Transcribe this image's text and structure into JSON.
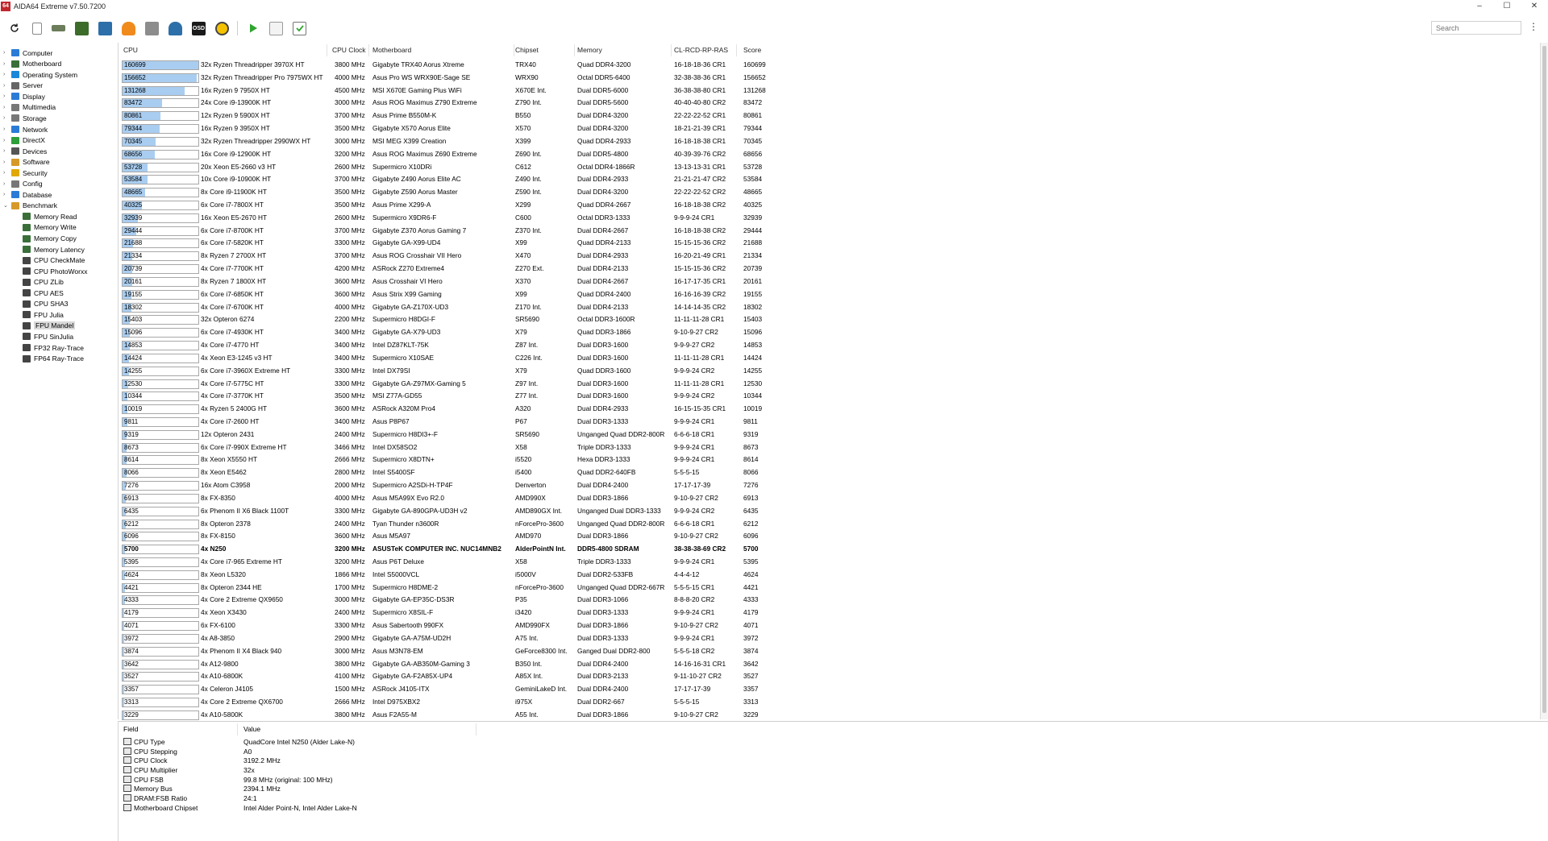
{
  "window": {
    "title": "AIDA64 Extreme v7.50.7200",
    "app_icon_text": "64",
    "minimize": "–",
    "maximize": "☐",
    "close": "✕"
  },
  "toolbar": {
    "icons": [
      "refresh-icon",
      "report-icon",
      "memory-icon",
      "motherboard-icon",
      "hardware-icon",
      "flame-icon",
      "network-icon",
      "user-icon",
      "osd-icon",
      "gauge-icon",
      "play-icon",
      "list-icon",
      "checklist-icon"
    ],
    "osd_label": "OSD",
    "search_placeholder": "Search",
    "menu_label": "⋮"
  },
  "tree": [
    {
      "label": "Computer",
      "arrow": "›",
      "color": "#2b7bd6"
    },
    {
      "label": "Motherboard",
      "arrow": "›",
      "color": "#3a6f3a"
    },
    {
      "label": "Operating System",
      "arrow": "›",
      "color": "#1c86d9"
    },
    {
      "label": "Server",
      "arrow": "›",
      "color": "#666666"
    },
    {
      "label": "Display",
      "arrow": "›",
      "color": "#2b7bd6"
    },
    {
      "label": "Multimedia",
      "arrow": "›",
      "color": "#777777"
    },
    {
      "label": "Storage",
      "arrow": "›",
      "color": "#777777"
    },
    {
      "label": "Network",
      "arrow": "›",
      "color": "#2b7bd6"
    },
    {
      "label": "DirectX",
      "arrow": "›",
      "color": "#2e9e3a"
    },
    {
      "label": "Devices",
      "arrow": "›",
      "color": "#555555"
    },
    {
      "label": "Software",
      "arrow": "›",
      "color": "#d69a2b"
    },
    {
      "label": "Security",
      "arrow": "›",
      "color": "#e0a800"
    },
    {
      "label": "Config",
      "arrow": "›",
      "color": "#777777"
    },
    {
      "label": "Database",
      "arrow": "›",
      "color": "#2b7bd6"
    },
    {
      "label": "Benchmark",
      "arrow": "⌄",
      "color": "#d69a2b"
    },
    {
      "label": "Memory Read",
      "arrow": "",
      "color": "#3a6f3a",
      "child": true
    },
    {
      "label": "Memory Write",
      "arrow": "",
      "color": "#3a6f3a",
      "child": true
    },
    {
      "label": "Memory Copy",
      "arrow": "",
      "color": "#3a6f3a",
      "child": true
    },
    {
      "label": "Memory Latency",
      "arrow": "",
      "color": "#3a6f3a",
      "child": true
    },
    {
      "label": "CPU CheckMate",
      "arrow": "",
      "color": "#444444",
      "child": true
    },
    {
      "label": "CPU PhotoWorxx",
      "arrow": "",
      "color": "#444444",
      "child": true
    },
    {
      "label": "CPU ZLib",
      "arrow": "",
      "color": "#444444",
      "child": true
    },
    {
      "label": "CPU AES",
      "arrow": "",
      "color": "#444444",
      "child": true
    },
    {
      "label": "CPU SHA3",
      "arrow": "",
      "color": "#444444",
      "child": true
    },
    {
      "label": "FPU Julia",
      "arrow": "",
      "color": "#444444",
      "child": true
    },
    {
      "label": "FPU Mandel",
      "arrow": "",
      "color": "#444444",
      "child": true,
      "selected": true
    },
    {
      "label": "FPU SinJulia",
      "arrow": "",
      "color": "#444444",
      "child": true
    },
    {
      "label": "FP32 Ray-Trace",
      "arrow": "",
      "color": "#444444",
      "child": true
    },
    {
      "label": "FP64 Ray-Trace",
      "arrow": "",
      "color": "#444444",
      "child": true
    }
  ],
  "list": {
    "headers": {
      "cpu": "CPU",
      "clock": "CPU Clock",
      "motherboard": "Motherboard",
      "chipset": "Chipset",
      "memory": "Memory",
      "timing": "CL-RCD-RP-RAS",
      "score": "Score"
    },
    "max_score": 160699,
    "rows": [
      {
        "score": "160699",
        "cpu": "32x Ryzen Threadripper 3970X HT",
        "clock": "3800 MHz",
        "mb": "Gigabyte TRX40 Aorus Xtreme",
        "chipset": "TRX40",
        "mem": "Quad DDR4-3200",
        "timing": "16-18-18-36 CR1"
      },
      {
        "score": "156652",
        "cpu": "32x Ryzen Threadripper Pro 7975WX HT",
        "clock": "4000 MHz",
        "mb": "Asus Pro WS WRX90E-Sage SE",
        "chipset": "WRX90",
        "mem": "Octal DDR5-6400",
        "timing": "32-38-38-36 CR1"
      },
      {
        "score": "131268",
        "cpu": "16x Ryzen 9 7950X HT",
        "clock": "4500 MHz",
        "mb": "MSI X670E Gaming Plus WiFi",
        "chipset": "X670E Int.",
        "mem": "Dual DDR5-6000",
        "timing": "36-38-38-80 CR1"
      },
      {
        "score": "83472",
        "cpu": "24x Core i9-13900K HT",
        "clock": "3000 MHz",
        "mb": "Asus ROG Maximus Z790 Extreme",
        "chipset": "Z790 Int.",
        "mem": "Dual DDR5-5600",
        "timing": "40-40-40-80 CR2"
      },
      {
        "score": "80861",
        "cpu": "12x Ryzen 9 5900X HT",
        "clock": "3700 MHz",
        "mb": "Asus Prime B550M-K",
        "chipset": "B550",
        "mem": "Dual DDR4-3200",
        "timing": "22-22-22-52 CR1"
      },
      {
        "score": "79344",
        "cpu": "16x Ryzen 9 3950X HT",
        "clock": "3500 MHz",
        "mb": "Gigabyte X570 Aorus Elite",
        "chipset": "X570",
        "mem": "Dual DDR4-3200",
        "timing": "18-21-21-39 CR1"
      },
      {
        "score": "70345",
        "cpu": "32x Ryzen Threadripper 2990WX HT",
        "clock": "3000 MHz",
        "mb": "MSI MEG X399 Creation",
        "chipset": "X399",
        "mem": "Quad DDR4-2933",
        "timing": "16-18-18-38 CR1"
      },
      {
        "score": "68656",
        "cpu": "16x Core i9-12900K HT",
        "clock": "3200 MHz",
        "mb": "Asus ROG Maximus Z690 Extreme",
        "chipset": "Z690 Int.",
        "mem": "Dual DDR5-4800",
        "timing": "40-39-39-76 CR2"
      },
      {
        "score": "53728",
        "cpu": "20x Xeon E5-2660 v3 HT",
        "clock": "2600 MHz",
        "mb": "Supermicro X10DRi",
        "chipset": "C612",
        "mem": "Octal DDR4-1866R",
        "timing": "13-13-13-31 CR1"
      },
      {
        "score": "53584",
        "cpu": "10x Core i9-10900K HT",
        "clock": "3700 MHz",
        "mb": "Gigabyte Z490 Aorus Elite AC",
        "chipset": "Z490 Int.",
        "mem": "Dual DDR4-2933",
        "timing": "21-21-21-47 CR2"
      },
      {
        "score": "48665",
        "cpu": "8x Core i9-11900K HT",
        "clock": "3500 MHz",
        "mb": "Gigabyte Z590 Aorus Master",
        "chipset": "Z590 Int.",
        "mem": "Dual DDR4-3200",
        "timing": "22-22-22-52 CR2"
      },
      {
        "score": "40325",
        "cpu": "6x Core i7-7800X HT",
        "clock": "3500 MHz",
        "mb": "Asus Prime X299-A",
        "chipset": "X299",
        "mem": "Quad DDR4-2667",
        "timing": "16-18-18-38 CR2"
      },
      {
        "score": "32939",
        "cpu": "16x Xeon E5-2670 HT",
        "clock": "2600 MHz",
        "mb": "Supermicro X9DR6-F",
        "chipset": "C600",
        "mem": "Octal DDR3-1333",
        "timing": "9-9-9-24 CR1"
      },
      {
        "score": "29444",
        "cpu": "6x Core i7-8700K HT",
        "clock": "3700 MHz",
        "mb": "Gigabyte Z370 Aorus Gaming 7",
        "chipset": "Z370 Int.",
        "mem": "Dual DDR4-2667",
        "timing": "16-18-18-38 CR2"
      },
      {
        "score": "21688",
        "cpu": "6x Core i7-5820K HT",
        "clock": "3300 MHz",
        "mb": "Gigabyte GA-X99-UD4",
        "chipset": "X99",
        "mem": "Quad DDR4-2133",
        "timing": "15-15-15-36 CR2"
      },
      {
        "score": "21334",
        "cpu": "8x Ryzen 7 2700X HT",
        "clock": "3700 MHz",
        "mb": "Asus ROG Crosshair VII Hero",
        "chipset": "X470",
        "mem": "Dual DDR4-2933",
        "timing": "16-20-21-49 CR1"
      },
      {
        "score": "20739",
        "cpu": "4x Core i7-7700K HT",
        "clock": "4200 MHz",
        "mb": "ASRock Z270 Extreme4",
        "chipset": "Z270 Ext.",
        "mem": "Dual DDR4-2133",
        "timing": "15-15-15-36 CR2"
      },
      {
        "score": "20161",
        "cpu": "8x Ryzen 7 1800X HT",
        "clock": "3600 MHz",
        "mb": "Asus Crosshair VI Hero",
        "chipset": "X370",
        "mem": "Dual DDR4-2667",
        "timing": "16-17-17-35 CR1"
      },
      {
        "score": "19155",
        "cpu": "6x Core i7-6850K HT",
        "clock": "3600 MHz",
        "mb": "Asus Strix X99 Gaming",
        "chipset": "X99",
        "mem": "Quad DDR4-2400",
        "timing": "16-16-16-39 CR2"
      },
      {
        "score": "18302",
        "cpu": "4x Core i7-6700K HT",
        "clock": "4000 MHz",
        "mb": "Gigabyte GA-Z170X-UD3",
        "chipset": "Z170 Int.",
        "mem": "Dual DDR4-2133",
        "timing": "14-14-14-35 CR2"
      },
      {
        "score": "15403",
        "cpu": "32x Opteron 6274",
        "clock": "2200 MHz",
        "mb": "Supermicro H8DGI-F",
        "chipset": "SR5690",
        "mem": "Octal DDR3-1600R",
        "timing": "11-11-11-28 CR1"
      },
      {
        "score": "15096",
        "cpu": "6x Core i7-4930K HT",
        "clock": "3400 MHz",
        "mb": "Gigabyte GA-X79-UD3",
        "chipset": "X79",
        "mem": "Quad DDR3-1866",
        "timing": "9-10-9-27 CR2"
      },
      {
        "score": "14853",
        "cpu": "4x Core i7-4770 HT",
        "clock": "3400 MHz",
        "mb": "Intel DZ87KLT-75K",
        "chipset": "Z87 Int.",
        "mem": "Dual DDR3-1600",
        "timing": "9-9-9-27 CR2"
      },
      {
        "score": "14424",
        "cpu": "4x Xeon E3-1245 v3 HT",
        "clock": "3400 MHz",
        "mb": "Supermicro X10SAE",
        "chipset": "C226 Int.",
        "mem": "Dual DDR3-1600",
        "timing": "11-11-11-28 CR1"
      },
      {
        "score": "14255",
        "cpu": "6x Core i7-3960X Extreme HT",
        "clock": "3300 MHz",
        "mb": "Intel DX79SI",
        "chipset": "X79",
        "mem": "Quad DDR3-1600",
        "timing": "9-9-9-24 CR2"
      },
      {
        "score": "12530",
        "cpu": "4x Core i7-5775C HT",
        "clock": "3300 MHz",
        "mb": "Gigabyte GA-Z97MX-Gaming 5",
        "chipset": "Z97 Int.",
        "mem": "Dual DDR3-1600",
        "timing": "11-11-11-28 CR1"
      },
      {
        "score": "10344",
        "cpu": "4x Core i7-3770K HT",
        "clock": "3500 MHz",
        "mb": "MSI Z77A-GD55",
        "chipset": "Z77 Int.",
        "mem": "Dual DDR3-1600",
        "timing": "9-9-9-24 CR2"
      },
      {
        "score": "10019",
        "cpu": "4x Ryzen 5 2400G HT",
        "clock": "3600 MHz",
        "mb": "ASRock A320M Pro4",
        "chipset": "A320",
        "mem": "Dual DDR4-2933",
        "timing": "16-15-15-35 CR1"
      },
      {
        "score": "9811",
        "cpu": "4x Core i7-2600 HT",
        "clock": "3400 MHz",
        "mb": "Asus P8P67",
        "chipset": "P67",
        "mem": "Dual DDR3-1333",
        "timing": "9-9-9-24 CR1"
      },
      {
        "score": "9319",
        "cpu": "12x Opteron 2431",
        "clock": "2400 MHz",
        "mb": "Supermicro H8DI3+-F",
        "chipset": "SR5690",
        "mem": "Unganged Quad DDR2-800R",
        "timing": "6-6-6-18 CR1"
      },
      {
        "score": "8673",
        "cpu": "6x Core i7-990X Extreme HT",
        "clock": "3466 MHz",
        "mb": "Intel DX58SO2",
        "chipset": "X58",
        "mem": "Triple DDR3-1333",
        "timing": "9-9-9-24 CR1"
      },
      {
        "score": "8614",
        "cpu": "8x Xeon X5550 HT",
        "clock": "2666 MHz",
        "mb": "Supermicro X8DTN+",
        "chipset": "i5520",
        "mem": "Hexa DDR3-1333",
        "timing": "9-9-9-24 CR1"
      },
      {
        "score": "8066",
        "cpu": "8x Xeon E5462",
        "clock": "2800 MHz",
        "mb": "Intel S5400SF",
        "chipset": "i5400",
        "mem": "Quad DDR2-640FB",
        "timing": "5-5-5-15"
      },
      {
        "score": "7276",
        "cpu": "16x Atom C3958",
        "clock": "2000 MHz",
        "mb": "Supermicro A2SDi-H-TP4F",
        "chipset": "Denverton",
        "mem": "Dual DDR4-2400",
        "timing": "17-17-17-39"
      },
      {
        "score": "6913",
        "cpu": "8x FX-8350",
        "clock": "4000 MHz",
        "mb": "Asus M5A99X Evo R2.0",
        "chipset": "AMD990X",
        "mem": "Dual DDR3-1866",
        "timing": "9-10-9-27 CR2"
      },
      {
        "score": "6435",
        "cpu": "6x Phenom II X6 Black 1100T",
        "clock": "3300 MHz",
        "mb": "Gigabyte GA-890GPA-UD3H v2",
        "chipset": "AMD890GX Int.",
        "mem": "Unganged Dual DDR3-1333",
        "timing": "9-9-9-24 CR2"
      },
      {
        "score": "6212",
        "cpu": "8x Opteron 2378",
        "clock": "2400 MHz",
        "mb": "Tyan Thunder n3600R",
        "chipset": "nForcePro-3600",
        "mem": "Unganged Quad DDR2-800R",
        "timing": "6-6-6-18 CR1"
      },
      {
        "score": "6096",
        "cpu": "8x FX-8150",
        "clock": "3600 MHz",
        "mb": "Asus M5A97",
        "chipset": "AMD970",
        "mem": "Dual DDR3-1866",
        "timing": "9-10-9-27 CR2"
      },
      {
        "score": "5700",
        "cpu": "4x N250",
        "clock": "3200 MHz",
        "mb": "ASUSTeK COMPUTER INC. NUC14MNB2",
        "chipset": "AlderPointN Int.",
        "mem": "DDR5-4800 SDRAM",
        "timing": "38-38-38-69 CR2",
        "bold": true
      },
      {
        "score": "5395",
        "cpu": "4x Core i7-965 Extreme HT",
        "clock": "3200 MHz",
        "mb": "Asus P6T Deluxe",
        "chipset": "X58",
        "mem": "Triple DDR3-1333",
        "timing": "9-9-9-24 CR1"
      },
      {
        "score": "4624",
        "cpu": "8x Xeon L5320",
        "clock": "1866 MHz",
        "mb": "Intel S5000VCL",
        "chipset": "i5000V",
        "mem": "Dual DDR2-533FB",
        "timing": "4-4-4-12"
      },
      {
        "score": "4421",
        "cpu": "8x Opteron 2344 HE",
        "clock": "1700 MHz",
        "mb": "Supermicro H8DME-2",
        "chipset": "nForcePro-3600",
        "mem": "Unganged Quad DDR2-667R",
        "timing": "5-5-5-15 CR1"
      },
      {
        "score": "4333",
        "cpu": "4x Core 2 Extreme QX9650",
        "clock": "3000 MHz",
        "mb": "Gigabyte GA-EP35C-DS3R",
        "chipset": "P35",
        "mem": "Dual DDR3-1066",
        "timing": "8-8-8-20 CR2"
      },
      {
        "score": "4179",
        "cpu": "4x Xeon X3430",
        "clock": "2400 MHz",
        "mb": "Supermicro X8SIL-F",
        "chipset": "i3420",
        "mem": "Dual DDR3-1333",
        "timing": "9-9-9-24 CR1"
      },
      {
        "score": "4071",
        "cpu": "6x FX-6100",
        "clock": "3300 MHz",
        "mb": "Asus Sabertooth 990FX",
        "chipset": "AMD990FX",
        "mem": "Dual DDR3-1866",
        "timing": "9-10-9-27 CR2"
      },
      {
        "score": "3972",
        "cpu": "4x A8-3850",
        "clock": "2900 MHz",
        "mb": "Gigabyte GA-A75M-UD2H",
        "chipset": "A75 Int.",
        "mem": "Dual DDR3-1333",
        "timing": "9-9-9-24 CR1"
      },
      {
        "score": "3874",
        "cpu": "4x Phenom II X4 Black 940",
        "clock": "3000 MHz",
        "mb": "Asus M3N78-EM",
        "chipset": "GeForce8300 Int.",
        "mem": "Ganged Dual DDR2-800",
        "timing": "5-5-5-18 CR2"
      },
      {
        "score": "3642",
        "cpu": "4x A12-9800",
        "clock": "3800 MHz",
        "mb": "Gigabyte GA-AB350M-Gaming 3",
        "chipset": "B350 Int.",
        "mem": "Dual DDR4-2400",
        "timing": "14-16-16-31 CR1"
      },
      {
        "score": "3527",
        "cpu": "4x A10-6800K",
        "clock": "4100 MHz",
        "mb": "Gigabyte GA-F2A85X-UP4",
        "chipset": "A85X Int.",
        "mem": "Dual DDR3-2133",
        "timing": "9-11-10-27 CR2"
      },
      {
        "score": "3357",
        "cpu": "4x Celeron J4105",
        "clock": "1500 MHz",
        "mb": "ASRock J4105-ITX",
        "chipset": "GeminiLakeD Int.",
        "mem": "Dual DDR4-2400",
        "timing": "17-17-17-39"
      },
      {
        "score": "3313",
        "cpu": "4x Core 2 Extreme QX6700",
        "clock": "2666 MHz",
        "mb": "Intel D975XBX2",
        "chipset": "i975X",
        "mem": "Dual DDR2-667",
        "timing": "5-5-5-15"
      },
      {
        "score": "3229",
        "cpu": "4x A10-5800K",
        "clock": "3800 MHz",
        "mb": "Asus F2A55-M",
        "chipset": "A55 Int.",
        "mem": "Dual DDR3-1866",
        "timing": "9-10-9-27 CR2"
      }
    ]
  },
  "detail": {
    "headers": {
      "field": "Field",
      "value": "Value"
    },
    "rows": [
      {
        "field": "CPU Type",
        "value": "QuadCore Intel N250  (Alder Lake-N)"
      },
      {
        "field": "CPU Stepping",
        "value": "A0"
      },
      {
        "field": "CPU Clock",
        "value": "3192.2 MHz"
      },
      {
        "field": "CPU Multiplier",
        "value": "32x"
      },
      {
        "field": "CPU FSB",
        "value": "99.8 MHz  (original: 100 MHz)"
      },
      {
        "field": "Memory Bus",
        "value": "2394.1 MHz"
      },
      {
        "field": "DRAM:FSB Ratio",
        "value": "24:1"
      },
      {
        "field": "Motherboard Chipset",
        "value": "Intel Alder Point-N, Intel Alder Lake-N"
      }
    ]
  }
}
